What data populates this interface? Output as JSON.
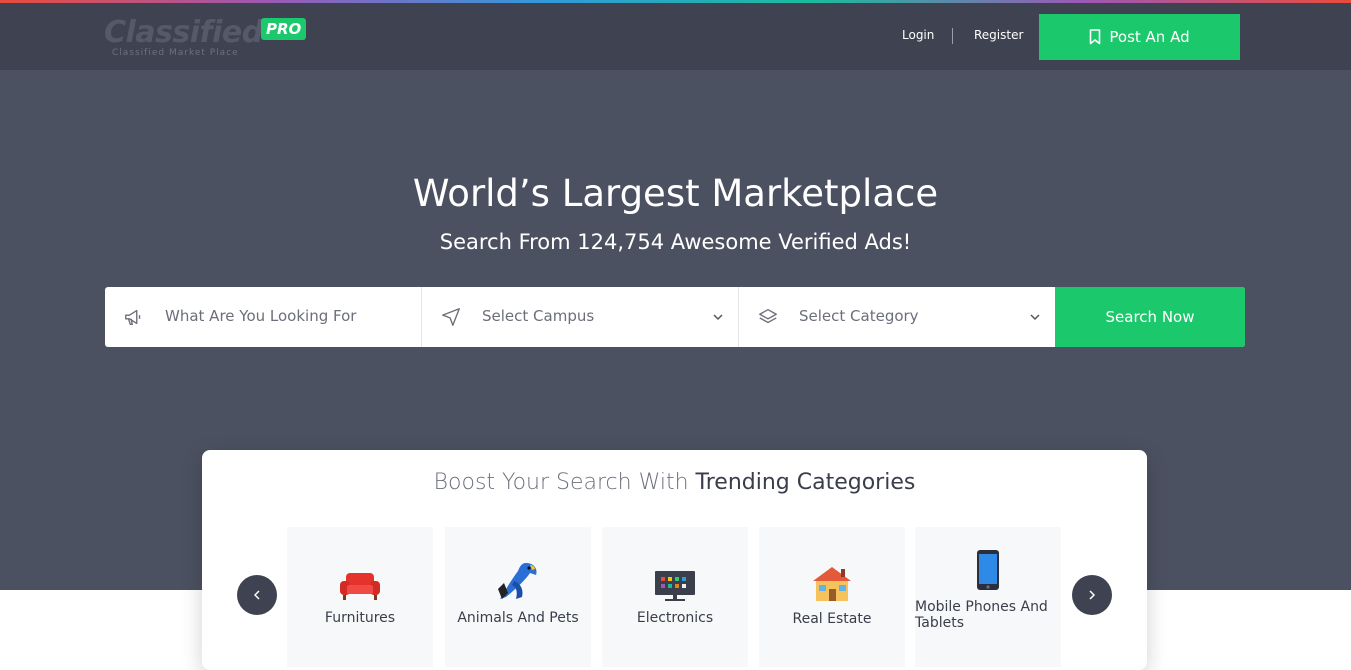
{
  "header": {
    "logo_text": "Classified",
    "logo_badge": "PRO",
    "logo_tagline": "Classified Market Place",
    "login_label": "Login",
    "register_label": "Register",
    "post_ad_label": "Post An Ad"
  },
  "hero": {
    "title": "World’s Largest Marketplace",
    "subtitle": "Search From 124,754 Awesome Verified Ads!"
  },
  "search": {
    "keyword_placeholder": "What Are You Looking For",
    "campus_placeholder": "Select Campus",
    "category_placeholder": "Select Category",
    "button_label": "Search Now"
  },
  "trending": {
    "title_light": "Boost Your Search With ",
    "title_strong": "Trending Categories",
    "categories": [
      {
        "label": "Furnitures",
        "icon": "sofa-icon"
      },
      {
        "label": "Animals And Pets",
        "icon": "parrot-icon"
      },
      {
        "label": "Electronics",
        "icon": "monitor-icon"
      },
      {
        "label": "Real Estate",
        "icon": "house-icon"
      },
      {
        "label": "Mobile Phones And Tablets",
        "icon": "smartphone-icon"
      }
    ]
  },
  "colors": {
    "accent_green": "#1cc86c",
    "header_bg": "#3e4251",
    "hero_bg": "#4c5161"
  }
}
